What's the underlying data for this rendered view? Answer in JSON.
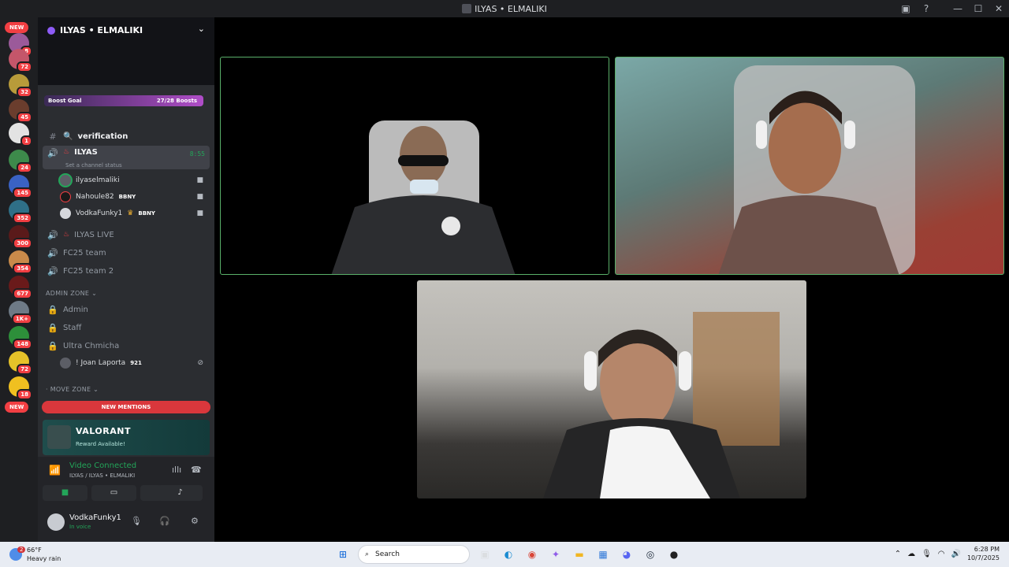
{
  "window": {
    "title": "ILYAS • ELMALIKI",
    "minimize": "—",
    "maximize": "☐",
    "close": "✕"
  },
  "guilds": {
    "new_top": "NEW",
    "new_bottom": "NEW",
    "badges": [
      "8",
      "72",
      "32",
      "45",
      "1",
      "24",
      "145",
      "352",
      "300",
      "354",
      "677",
      "1K+",
      "148",
      "72",
      "18"
    ]
  },
  "server": {
    "name": "ILYAS • ELMALIKI",
    "boost_label": "Boost Goal",
    "boost_value": "27/28 Boosts"
  },
  "channels": {
    "verification": "verification",
    "voice_active": {
      "name": "ILYAS",
      "timer": "8:55",
      "status": "Set a channel status",
      "members": [
        {
          "name": "ilyaselmaliki",
          "tag": ""
        },
        {
          "name": "Nahoule82",
          "tag": "BBNY"
        },
        {
          "name": "VodkaFunky1",
          "tag": "BBNY"
        }
      ]
    },
    "live": "ILYAS LIVE",
    "fc25": "FC25 team",
    "fc25_2": "FC25 team 2",
    "admin_zone": "ADMIN ZONE",
    "admin": "Admin",
    "staff": "Staff",
    "ultra": "Ultra Chmicha",
    "laporta": "! Joan Laporta",
    "laporta_tag": "921",
    "move_zone": "MOVE ZONE",
    "new_mentions": "NEW MENTIONS"
  },
  "promo": {
    "title": "VALORANT",
    "subtitle": "Reward Available!"
  },
  "voice_panel": {
    "status": "Video Connected",
    "channel": "ILYAS / ILYAS • ELMALIKI"
  },
  "user": {
    "name": "VodkaFunky1",
    "status": "In voice"
  },
  "taskbar": {
    "temp": "66°F",
    "condition": "Heavy rain",
    "weather_badge": "2",
    "search": "Search",
    "time": "6:28 PM",
    "date": "10/7/2025"
  }
}
